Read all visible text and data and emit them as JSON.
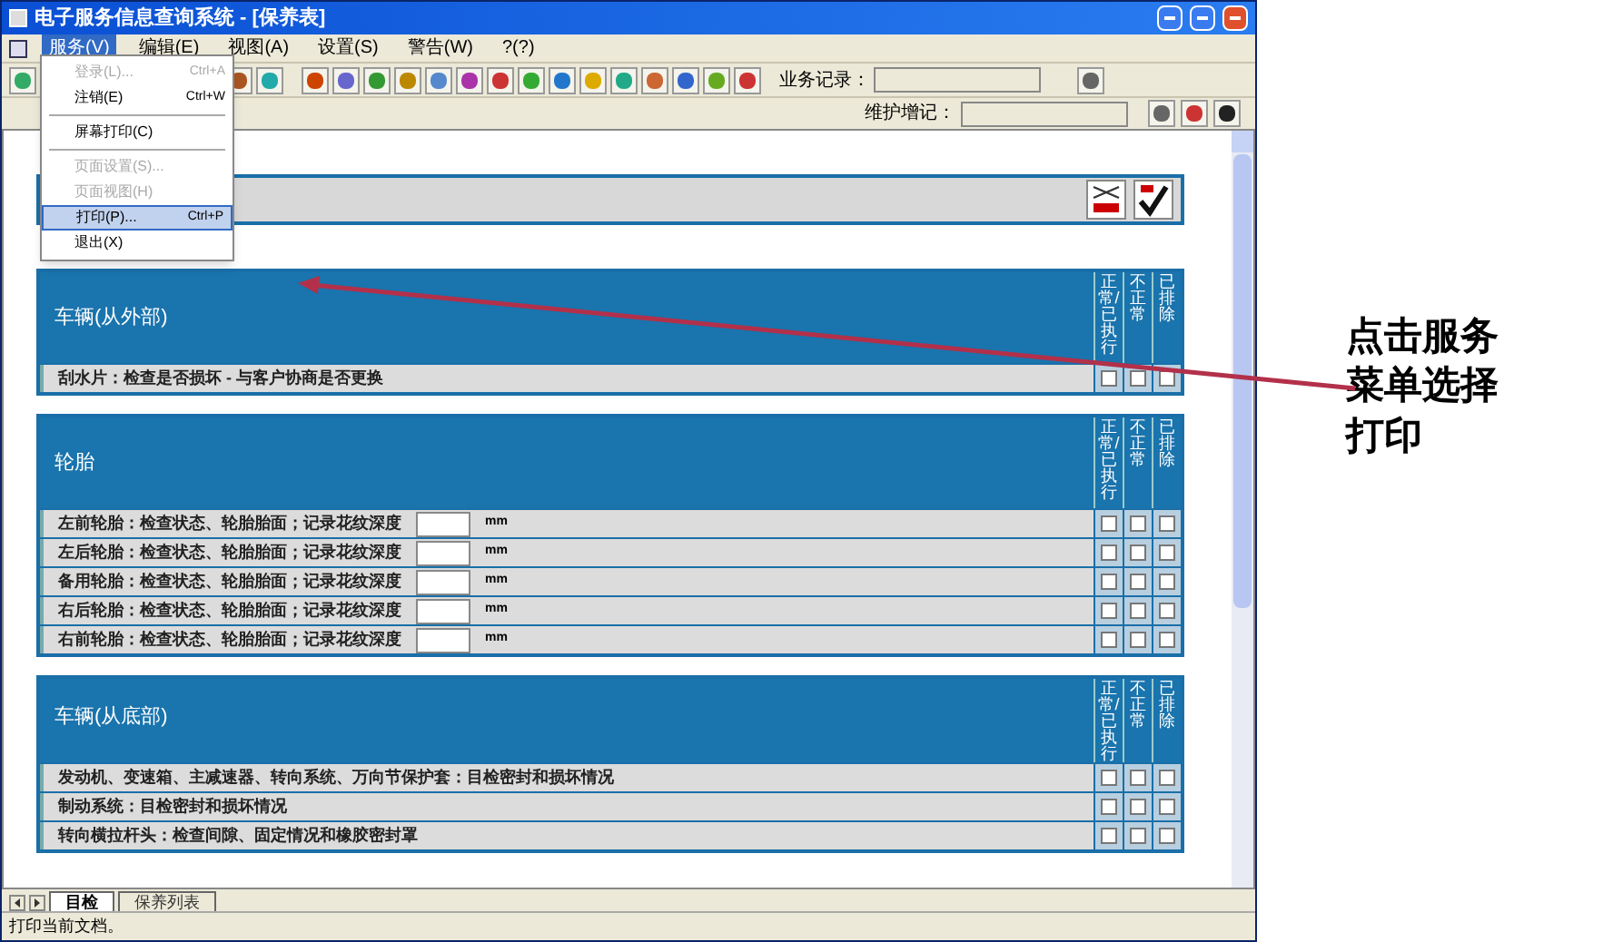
{
  "window": {
    "title": "电子服务信息查询系统 - [保养表]"
  },
  "menu": [
    {
      "label": "服务(V)",
      "selected": true
    },
    {
      "label": "编辑(E)",
      "selected": false
    },
    {
      "label": "视图(A)",
      "selected": false
    },
    {
      "label": "设置(S)",
      "selected": false
    },
    {
      "label": "警告(W)",
      "selected": false
    },
    {
      "label": "?(?)",
      "selected": false
    }
  ],
  "dropdown": [
    {
      "kind": "item",
      "label": "登录(L)...",
      "shortcut": "Ctrl+A",
      "disabled": true,
      "selected": false
    },
    {
      "kind": "item",
      "label": "注销(E)",
      "shortcut": "Ctrl+W",
      "disabled": false,
      "selected": false
    },
    {
      "kind": "separator"
    },
    {
      "kind": "item",
      "label": "屏幕打印(C)",
      "disabled": false,
      "selected": false
    },
    {
      "kind": "separator"
    },
    {
      "kind": "item",
      "label": "页面设置(S)...",
      "disabled": true,
      "selected": false
    },
    {
      "kind": "item",
      "label": "页面视图(H)",
      "disabled": true,
      "selected": false
    },
    {
      "kind": "item",
      "label": "打印(P)...",
      "shortcut": "Ctrl+P",
      "disabled": false,
      "selected": true
    },
    {
      "kind": "item",
      "label": "退出(X)",
      "disabled": false,
      "selected": false
    }
  ],
  "toolbar": {
    "record_label": "业务记录：",
    "maintenance_label": "维护增记："
  },
  "sections": [
    {
      "title": "车辆(从外部)",
      "columns": [
        "正常/已执行",
        "不正常",
        "已排除"
      ],
      "rows": [
        {
          "text": "刮水片：检查是否损坏 - 与客户协商是否更换",
          "checks": [
            false,
            false,
            false
          ]
        }
      ]
    },
    {
      "title": "轮胎",
      "columns": [
        "正常/已执行",
        "不正常",
        "已排除"
      ],
      "rows": [
        {
          "text": "左前轮胎：检查状态、轮胎胎面；记录花纹深度",
          "unit": "mm",
          "checks": [
            false,
            false,
            false
          ]
        },
        {
          "text": "左后轮胎：检查状态、轮胎胎面；记录花纹深度",
          "unit": "mm",
          "checks": [
            false,
            false,
            false
          ]
        },
        {
          "text": "备用轮胎：检查状态、轮胎胎面；记录花纹深度",
          "unit": "mm",
          "checks": [
            false,
            false,
            false
          ]
        },
        {
          "text": "右后轮胎：检查状态、轮胎胎面；记录花纹深度",
          "unit": "mm",
          "checks": [
            false,
            false,
            false
          ]
        },
        {
          "text": "右前轮胎：检查状态、轮胎胎面；记录花纹深度",
          "unit": "mm",
          "checks": [
            false,
            false,
            false
          ]
        }
      ]
    },
    {
      "title": "车辆(从底部)",
      "columns": [
        "正常/已执行",
        "不正常",
        "已排除"
      ],
      "rows": [
        {
          "text": "发动机、变速箱、主减速器、转向系统、万向节保护套：目检密封和损坏情况",
          "checks": [
            false,
            false,
            false
          ]
        },
        {
          "text": "制动系统：目检密封和损坏情况",
          "checks": [
            false,
            false,
            false
          ]
        },
        {
          "text": "转向横拉杆头：检查间隙、固定情况和橡胶密封罩",
          "checks": [
            false,
            false,
            false
          ]
        }
      ]
    }
  ],
  "tabs": [
    {
      "label": "目检",
      "selected": true
    },
    {
      "label": "保养列表",
      "selected": false
    }
  ],
  "status_bar": "打印当前文档。",
  "annotation": "点击服务菜单选择打印"
}
